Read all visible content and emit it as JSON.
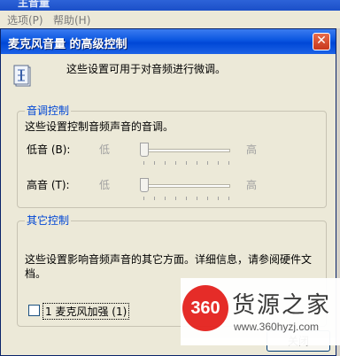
{
  "background_window": {
    "title": "主音量",
    "menu": [
      "选项(P)",
      "帮助(H)"
    ]
  },
  "dialog": {
    "title": "麦克风音量 的高级控制",
    "close_glyph": "✕",
    "intro": "这些设置可用于对音频进行微调。",
    "tone_group": {
      "legend": "音调控制",
      "description": "这些设置控制音频声音的音调。",
      "bass": {
        "label": "低音 (B):",
        "low": "低",
        "high": "高",
        "level": 0
      },
      "treble": {
        "label": "高音 (T):",
        "low": "低",
        "high": "高",
        "level": 0
      }
    },
    "other_group": {
      "legend": "其它控制",
      "description_line1": "这些设置影响音频声音的其它方面。详细信息，请参阅硬件文",
      "description_line2": "档。",
      "checkbox_label": "1  麦克风加强 (1)",
      "checked": false
    },
    "close_button": "关闭"
  },
  "watermark": {
    "logo": "360",
    "brand": "货源之家",
    "url": "www.360hyzj.com"
  }
}
